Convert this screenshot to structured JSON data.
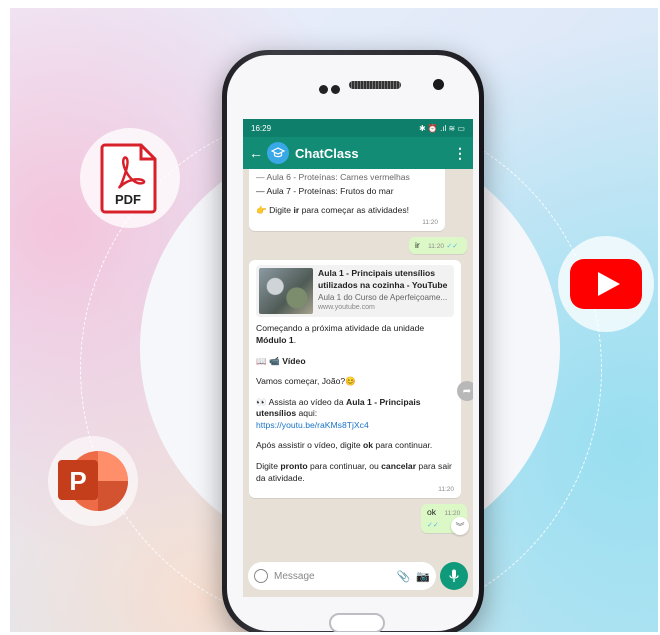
{
  "status_bar": {
    "time": "16:29",
    "icons": "✱ ⏰ .ıl ≋ ▭"
  },
  "app_bar": {
    "title": "ChatClass",
    "back": "←",
    "menu": "⋮"
  },
  "messages": {
    "m1": {
      "line_cut": "— Aula 6 - Proteínas: Carnes vermelhas",
      "line2": "— Aula 7 - Proteínas: Frutos do mar",
      "emoji": "👉",
      "prefix": "Digite ",
      "bold": "ir",
      "suffix": " para começar as atividades!",
      "time": "11:20"
    },
    "m2": {
      "text": "ir",
      "time": "11:20",
      "ticks": "✓✓"
    },
    "m3": {
      "preview_title": "Aula 1 - Principais utensílios utilizados na cozinha - YouTube",
      "preview_sub": "Aula 1 do Curso de Aperfeiçoame...",
      "preview_url": "www.youtube.com",
      "p1_a": "Começando a próxima atividade da unidade ",
      "p1_b": "Módulo 1",
      "p1_c": ".",
      "video_emoji": "📖 📹",
      "video_label": "Vídeo",
      "greet": "Vamos começar, João?",
      "greet_emoji": "😊",
      "watch_emoji": "👀",
      "watch_a": " Assista ao vídeo da ",
      "watch_b": "Aula 1 - Principais utensílios",
      "watch_c": " aqui:",
      "link": "https://youtu.be/raKMs8TjXc4",
      "after_a": "Após assistir o vídeo, digite ",
      "after_b": "ok",
      "after_c": " para continuar.",
      "final_a": "Digite ",
      "final_b": "pronto",
      "final_c": " para continuar, ou ",
      "final_d": "cancelar",
      "final_e": " para sair da atividade.",
      "time": "11:20"
    },
    "m4": {
      "text": "ok",
      "time": "11:20",
      "ticks": "✓✓"
    }
  },
  "input": {
    "placeholder": "Message"
  },
  "icons": {
    "pdf_label": "PDF",
    "ppt_label": "P",
    "youtube": "youtube-logo",
    "powerpoint": "powerpoint-logo",
    "pdf": "pdf-file-icon"
  },
  "colors": {
    "app_bar": "#128c74",
    "status_bar": "#0d7f6a",
    "outgoing_bubble": "#dcf8c6",
    "youtube_red": "#ff0000",
    "ppt_orange": "#d24726"
  }
}
